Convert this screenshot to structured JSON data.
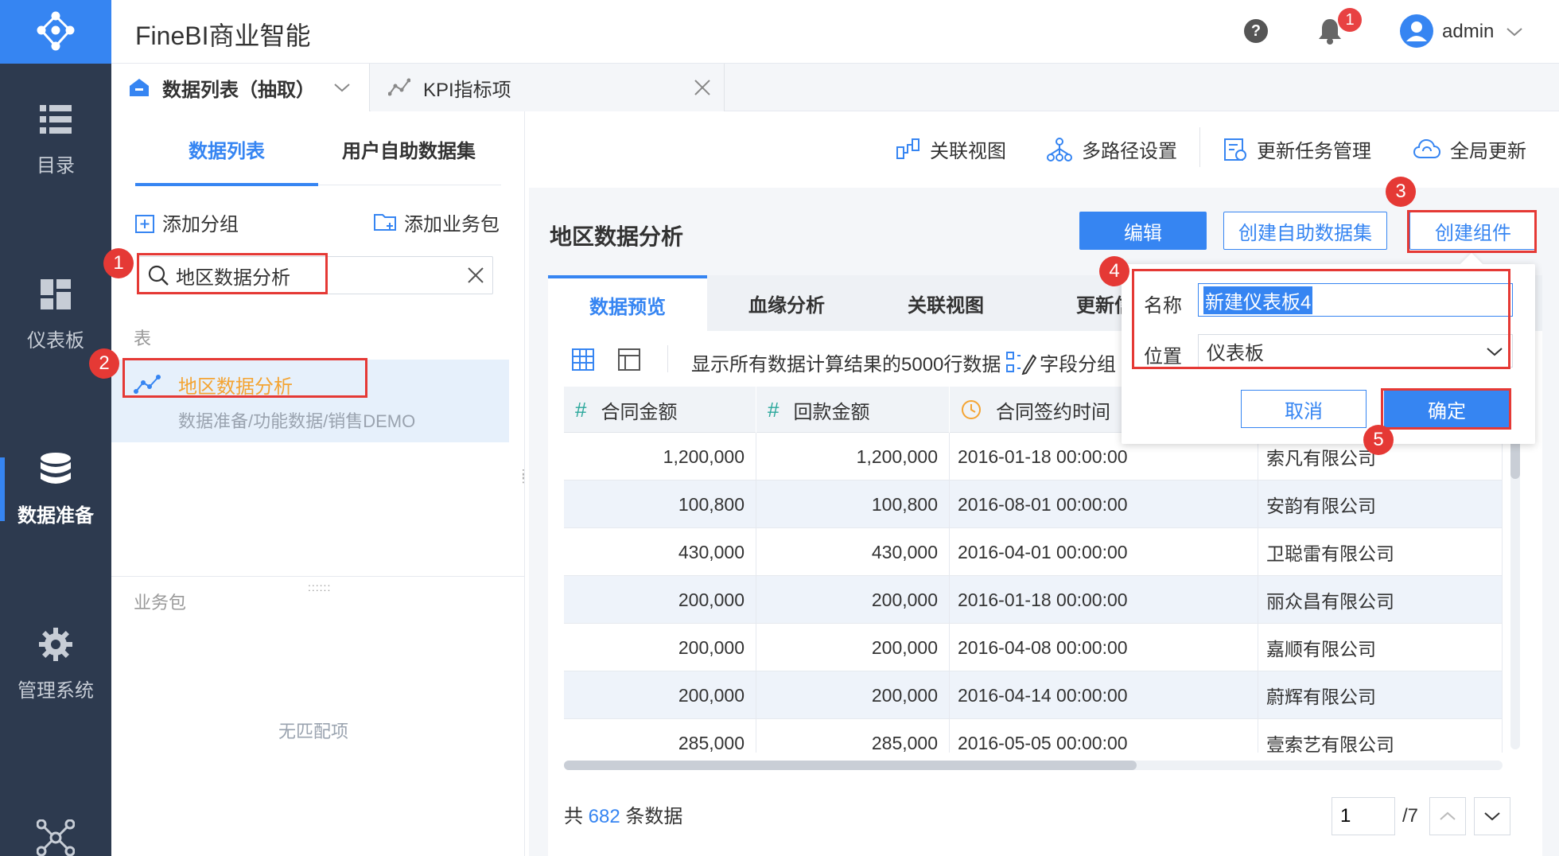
{
  "app": {
    "title": "FineBI商业智能"
  },
  "header": {
    "notification_count": "1",
    "username": "admin"
  },
  "nav": {
    "items": [
      {
        "label": "目录",
        "icon": "list-icon"
      },
      {
        "label": "仪表板",
        "icon": "dashboard-icon"
      },
      {
        "label": "数据准备",
        "icon": "database-icon",
        "active": true
      },
      {
        "label": "管理系统",
        "icon": "gear-icon"
      }
    ]
  },
  "page_tabs": [
    {
      "label": "数据列表（抽取）",
      "icon": "home-icon"
    },
    {
      "label": "KPI指标项",
      "icon": "chart-line-icon"
    }
  ],
  "left_panel": {
    "tabs": [
      "数据列表",
      "用户自助数据集"
    ],
    "add_group": "添加分组",
    "add_package": "添加业务包",
    "search_value": "地区数据分析",
    "section_table": "表",
    "result_name": "地区数据分析",
    "result_path": "数据准备/功能数据/销售DEMO",
    "section_package": "业务包",
    "no_match": "无匹配项"
  },
  "toolbar": {
    "relation_view": "关联视图",
    "multipath": "多路径设置",
    "update_tasks": "更新任务管理",
    "global_update": "全局更新"
  },
  "main": {
    "title": "地区数据分析",
    "edit_button": "编辑",
    "create_dataset_button": "创建自助数据集",
    "create_component_button": "创建组件",
    "content_tabs": [
      "数据预览",
      "血缘分析",
      "关联视图",
      "更新信"
    ],
    "preview_note": "显示所有数据计算结果的5000行数据",
    "field_group": "字段分组"
  },
  "table": {
    "columns": [
      {
        "label": "合同金额",
        "type": "#"
      },
      {
        "label": "回款金额",
        "type": "#"
      },
      {
        "label": "合同签约时间",
        "type": "date"
      }
    ],
    "rows": [
      [
        "1,200,000",
        "1,200,000",
        "2016-01-18 00:00:00",
        "索凡有限公司"
      ],
      [
        "100,800",
        "100,800",
        "2016-08-01 00:00:00",
        "安韵有限公司"
      ],
      [
        "430,000",
        "430,000",
        "2016-04-01 00:00:00",
        "卫聪雷有限公司"
      ],
      [
        "200,000",
        "200,000",
        "2016-01-18 00:00:00",
        "丽众昌有限公司"
      ],
      [
        "200,000",
        "200,000",
        "2016-04-08 00:00:00",
        "嘉顺有限公司"
      ],
      [
        "200,000",
        "200,000",
        "2016-04-14 00:00:00",
        "蔚辉有限公司"
      ],
      [
        "285,000",
        "285,000",
        "2016-05-05 00:00:00",
        "壹索艺有限公司"
      ]
    ]
  },
  "footer": {
    "count_prefix": "共",
    "count": "682",
    "count_suffix": "条数据",
    "page": "1",
    "page_total": "/7"
  },
  "dialog": {
    "name_label": "名称",
    "name_value": "新建仪表板4",
    "position_label": "位置",
    "position_value": "仪表板",
    "cancel": "取消",
    "confirm": "确定"
  },
  "markers": [
    "1",
    "2",
    "3",
    "4",
    "5"
  ],
  "colors": {
    "primary": "#3685f2",
    "sidebar": "#2d3a4f",
    "highlight_text": "#f4a433",
    "annotation_red": "#e53935"
  }
}
